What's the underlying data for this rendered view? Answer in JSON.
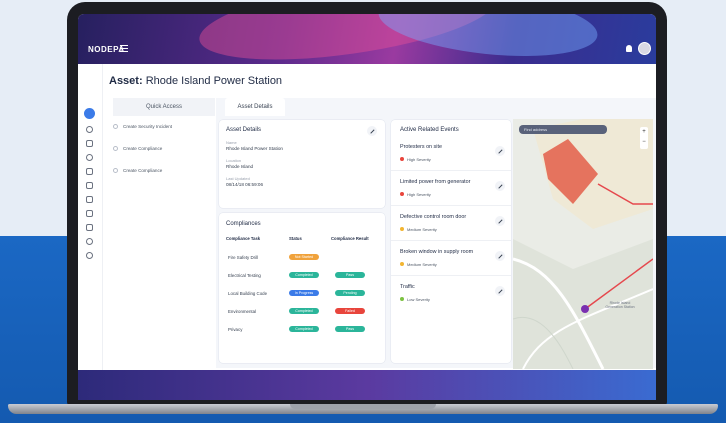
{
  "header": {
    "logo": "NODEPA"
  },
  "page": {
    "title_prefix": "Asset:",
    "title_name": "Rhode Island Power Station"
  },
  "quick_access": {
    "tab_label": "Quick Access",
    "items": [
      "Create Security Incident",
      "Create Compliance",
      "Create Compliance"
    ]
  },
  "asset_details_tab": "Asset Details",
  "asset_details": {
    "title": "Asset Details",
    "fields": [
      {
        "label": "Name",
        "value": "Rhode Island Power Station"
      },
      {
        "label": "Location",
        "value": "Rhode Island"
      },
      {
        "label": "Last Updated",
        "value": "08/14/18 06:59:06"
      }
    ]
  },
  "compliances": {
    "title": "Compliances",
    "columns": [
      "Compliance Task",
      "Status",
      "Compliance Result"
    ],
    "rows": [
      {
        "task": "Fire Safety Drill",
        "status": "Not Started",
        "result": ""
      },
      {
        "task": "Electrical Testing",
        "status": "Completed",
        "result": "Pass"
      },
      {
        "task": "Local Building Code",
        "status": "In Progress",
        "result": "Pending"
      },
      {
        "task": "Environmental",
        "status": "Completed",
        "result": "Failed"
      },
      {
        "task": "Privacy",
        "status": "Completed",
        "result": "Pass"
      }
    ]
  },
  "events": {
    "title": "Active Related Events",
    "items": [
      {
        "title": "Protesters on site",
        "severity": "High Severity",
        "color": "#e8453c"
      },
      {
        "title": "Limited power from generator",
        "severity": "High Severity",
        "color": "#e8453c"
      },
      {
        "title": "Defective control room door",
        "severity": "Medium Severity",
        "color": "#f2b531"
      },
      {
        "title": "Broken window in supply room",
        "severity": "Medium Severity",
        "color": "#f2b531"
      },
      {
        "title": "Traffic",
        "severity": "Low Severity",
        "color": "#7cc242"
      }
    ]
  },
  "map": {
    "address_placeholder": "Find address",
    "zoom_in": "+",
    "zoom_out": "−",
    "label": "Rhode Island Generation Station"
  },
  "colors": {
    "not_started": "#f0a23b",
    "completed": "#2bb59a",
    "in_progress": "#3b7be8",
    "pass": "#2bb59a",
    "pending": "#2bb59a",
    "failed": "#e8453c",
    "accent": "#3b7be8"
  }
}
